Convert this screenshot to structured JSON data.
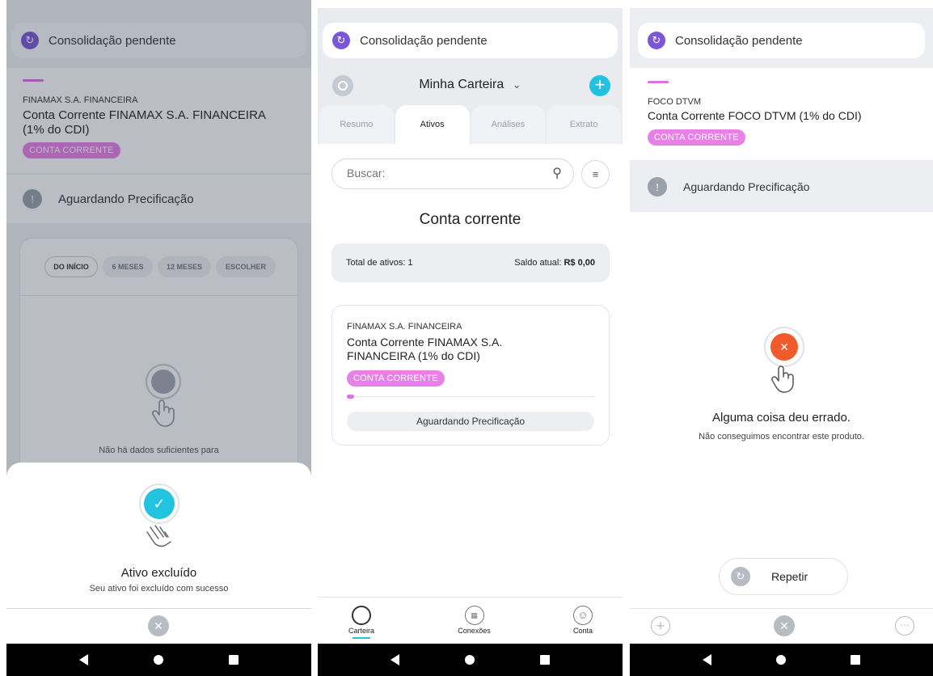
{
  "panel1": {
    "pending_label": "Consolidação pendente",
    "institution": "FINAMAX S.A.  FINANCEIRA",
    "account_title": "Conta Corrente FINAMAX S.A.  FINANCEIRA (1% do CDI)",
    "tag": "CONTA CORRENTE",
    "status": "Aguardando Precificação",
    "periods": [
      "DO INÍCIO",
      "6 MESES",
      "12 MESES",
      "ESCOLHER"
    ],
    "no_data_text": "Não há dados suficientes para",
    "sheet_title": "Ativo excluído",
    "sheet_subtitle": "Seu ativo foi excluído com sucesso"
  },
  "panel2": {
    "pending_label": "Consolidação pendente",
    "wallet_title": "Minha Carteira",
    "tabs": [
      "Resumo",
      "Ativos",
      "Análises",
      "Extrato"
    ],
    "active_tab": "Ativos",
    "search_placeholder": "Buscar:",
    "section_title": "Conta corrente",
    "total_label": "Total de ativos: 1",
    "balance_label": "Saldo atual:",
    "balance_value": "R$ 0,00",
    "card": {
      "institution": "FINAMAX S.A.  FINANCEIRA",
      "title": "Conta Corrente FINAMAX S.A. FINANCEIRA (1% do CDI)",
      "tag": "CONTA CORRENTE",
      "status_button": "Aguardando Precificação"
    },
    "bottom_nav": [
      "Carteira",
      "Conexões",
      "Conta"
    ]
  },
  "panel3": {
    "pending_label": "Consolidação pendente",
    "institution": "FOCO DTVM",
    "account_title": "Conta Corrente FOCO DTVM (1% do CDI)",
    "tag": "CONTA CORRENTE",
    "status": "Aguardando Precificação",
    "error_title": "Alguma coisa deu errado.",
    "error_subtitle": "Não conseguimos encontrar este produto.",
    "retry_label": "Repetir"
  },
  "colors": {
    "purple": "#7b57d8",
    "magenta": "#e980e8",
    "teal": "#22c3e0",
    "orange": "#f15a2b",
    "gray_icon": "#9aa0aa"
  }
}
